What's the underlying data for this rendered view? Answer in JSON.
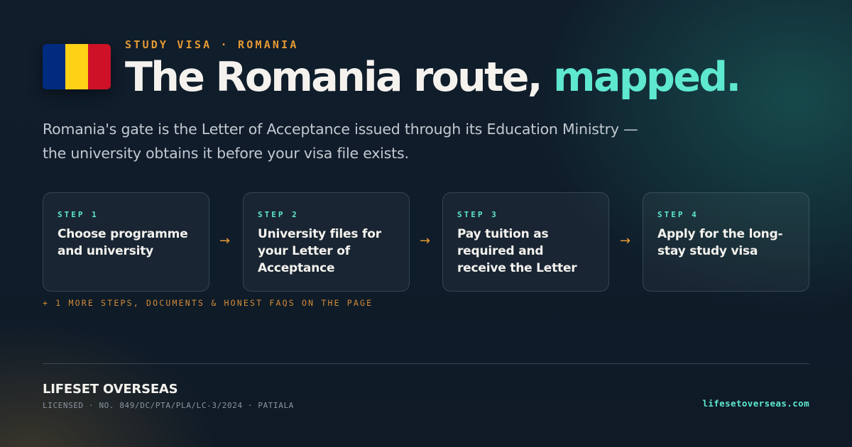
{
  "colors": {
    "accent_orange": "#e59a34",
    "accent_teal": "#5ee8cf",
    "flag_blue": "#002b7f",
    "flag_yellow": "#fcd116",
    "flag_red": "#ce1126"
  },
  "header": {
    "flag_icon": "romania-flag-icon",
    "eyebrow": "STUDY VISA · ROMANIA",
    "title_main": "The Romania route, ",
    "title_accent": "mapped."
  },
  "lede": "Romania's gate is the Letter of Acceptance issued through its Education Ministry — the university obtains it before your visa file exists.",
  "steps": [
    {
      "label": "STEP 1",
      "text": "Choose programme and university"
    },
    {
      "label": "STEP 2",
      "text": "University files for your Letter of Acceptance"
    },
    {
      "label": "STEP 3",
      "text": "Pay tuition as required and receive the Letter"
    },
    {
      "label": "STEP 4",
      "text": "Apply for the long-stay study visa"
    }
  ],
  "arrow_glyph": "→",
  "more_note": "+ 1 MORE STEPS, DOCUMENTS & HONEST FAQS ON THE PAGE",
  "footer": {
    "brand": "LIFESET OVERSEAS",
    "license": "LICENSED · NO. 849/DC/PTA/PLA/LC-3/2024 · PATIALA",
    "website": "lifesetoverseas.com"
  }
}
